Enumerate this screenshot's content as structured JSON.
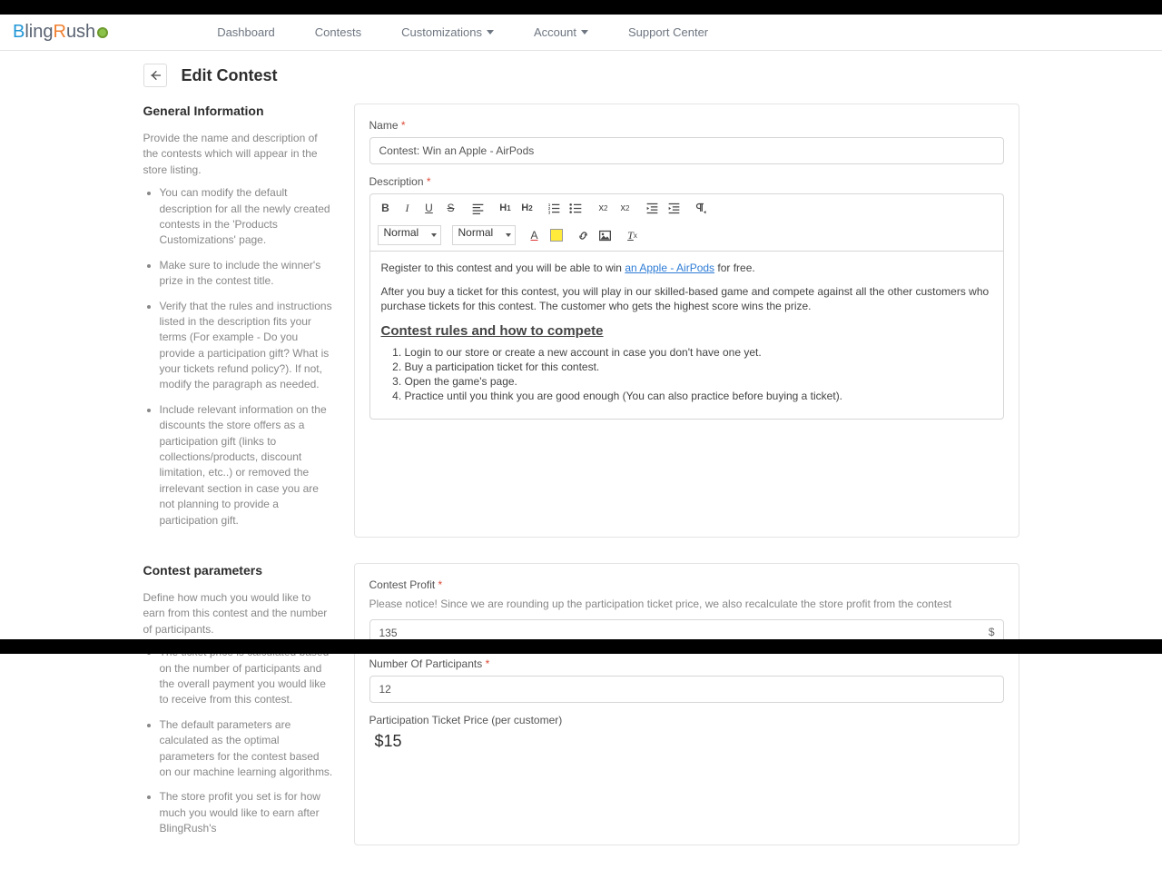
{
  "brand": {
    "part1": "Bling",
    "part2": "Rush"
  },
  "nav": {
    "dashboard": "Dashboard",
    "contests": "Contests",
    "customizations": "Customizations",
    "account": "Account",
    "support": "Support Center"
  },
  "header": {
    "title": "Edit Contest"
  },
  "left1": {
    "heading": "General Information",
    "intro": "Provide the name and description of the contests which will appear in the store listing.",
    "items": [
      "You can modify the default description for all the newly created contests in the 'Products Customizations' page.",
      "Make sure to include the winner's prize in the contest title.",
      "Verify that the rules and instructions listed in the description fits your terms (For example - Do you provide a participation gift? What is your tickets refund policy?). If not, modify the paragraph as needed.",
      "Include relevant information on the discounts the store offers as a participation gift (links to collections/products, discount limitation, etc..) or removed the irrelevant section in case you are not planning to provide a participation gift."
    ]
  },
  "form1": {
    "name_label": "Name",
    "name_value": "Contest: Win an Apple - AirPods",
    "description_label": "Description",
    "toolbar": {
      "font_select": "Normal",
      "size_select": "Normal"
    },
    "editor": {
      "p1_a": "Register to this contest and you will be able to win ",
      "p1_link": "an Apple - AirPods",
      "p1_b": " for free.",
      "p2": "After you buy a ticket for this contest, you will play in our skilled-based game and compete against all the other customers who purchase tickets for this contest. The customer who gets the highest score wins the prize.",
      "rules_heading": "Contest rules and how to compete",
      "rules": [
        "Login to our store or create a new account in case you don't have one yet.",
        "Buy a participation ticket for this contest.",
        "Open the game's page.",
        "Practice until you think you are good enough (You can also practice before buying a ticket)."
      ]
    }
  },
  "left2": {
    "heading": "Contest parameters",
    "intro": "Define how much you would like to earn from this contest and the number of participants.",
    "items": [
      "The ticket price is calculated based on the number of participants and the overall payment you would like to receive from this contest.",
      "The default parameters are calculated as the optimal parameters for the contest based on our machine learning algorithms.",
      "The store profit you set is for how much you would like to earn after BlingRush's"
    ]
  },
  "form2": {
    "profit_label": "Contest Profit",
    "profit_help": "Please notice! Since we are rounding up the participation ticket price, we also recalculate the store profit from the contest",
    "profit_value": "135",
    "profit_suffix": "$",
    "participants_label": "Number Of Participants",
    "participants_value": "12",
    "ticket_label": "Participation Ticket Price (per customer)",
    "ticket_value": "$15"
  }
}
